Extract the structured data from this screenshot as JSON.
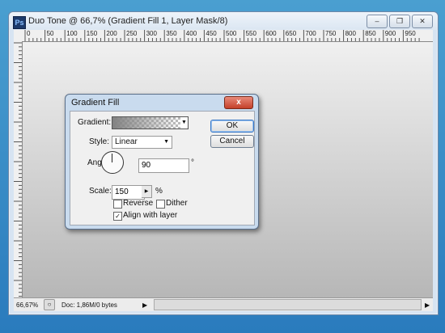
{
  "document_window": {
    "title": "Duo Tone @ 66,7% (Gradient Fill 1, Layer Mask/8)",
    "app_icon_text": "Ps",
    "window_buttons": [
      "minimize",
      "restore",
      "close"
    ],
    "ruler_labels": [
      "0",
      "50",
      "100",
      "150",
      "200",
      "250",
      "300",
      "350",
      "400",
      "450",
      "500",
      "550",
      "600",
      "650",
      "700",
      "750",
      "800",
      "850",
      "900",
      "950"
    ],
    "status": {
      "zoom": "66,67%",
      "doc_info": "Doc: 1,86M/0 bytes"
    }
  },
  "dialog": {
    "title": "Gradient Fill",
    "close_label": "x",
    "gradient_label": "Gradient:",
    "style_label": "Style:",
    "style_value": "Linear",
    "angle_label": "Angle:",
    "angle_value": "90",
    "angle_unit": "°",
    "scale_label": "Scale:",
    "scale_value": "150",
    "scale_unit": "%",
    "reverse_label": "Reverse",
    "reverse_checked": false,
    "dither_label": "Dither",
    "dither_checked": false,
    "align_label": "Align with layer",
    "align_checked": true,
    "ok_label": "OK",
    "cancel_label": "Cancel"
  },
  "colors": {
    "desktop": "#2a7bbd",
    "window_frame": "#d7e4f2",
    "dialog_frame": "#c9dbee",
    "close_button": "#c4402a"
  }
}
